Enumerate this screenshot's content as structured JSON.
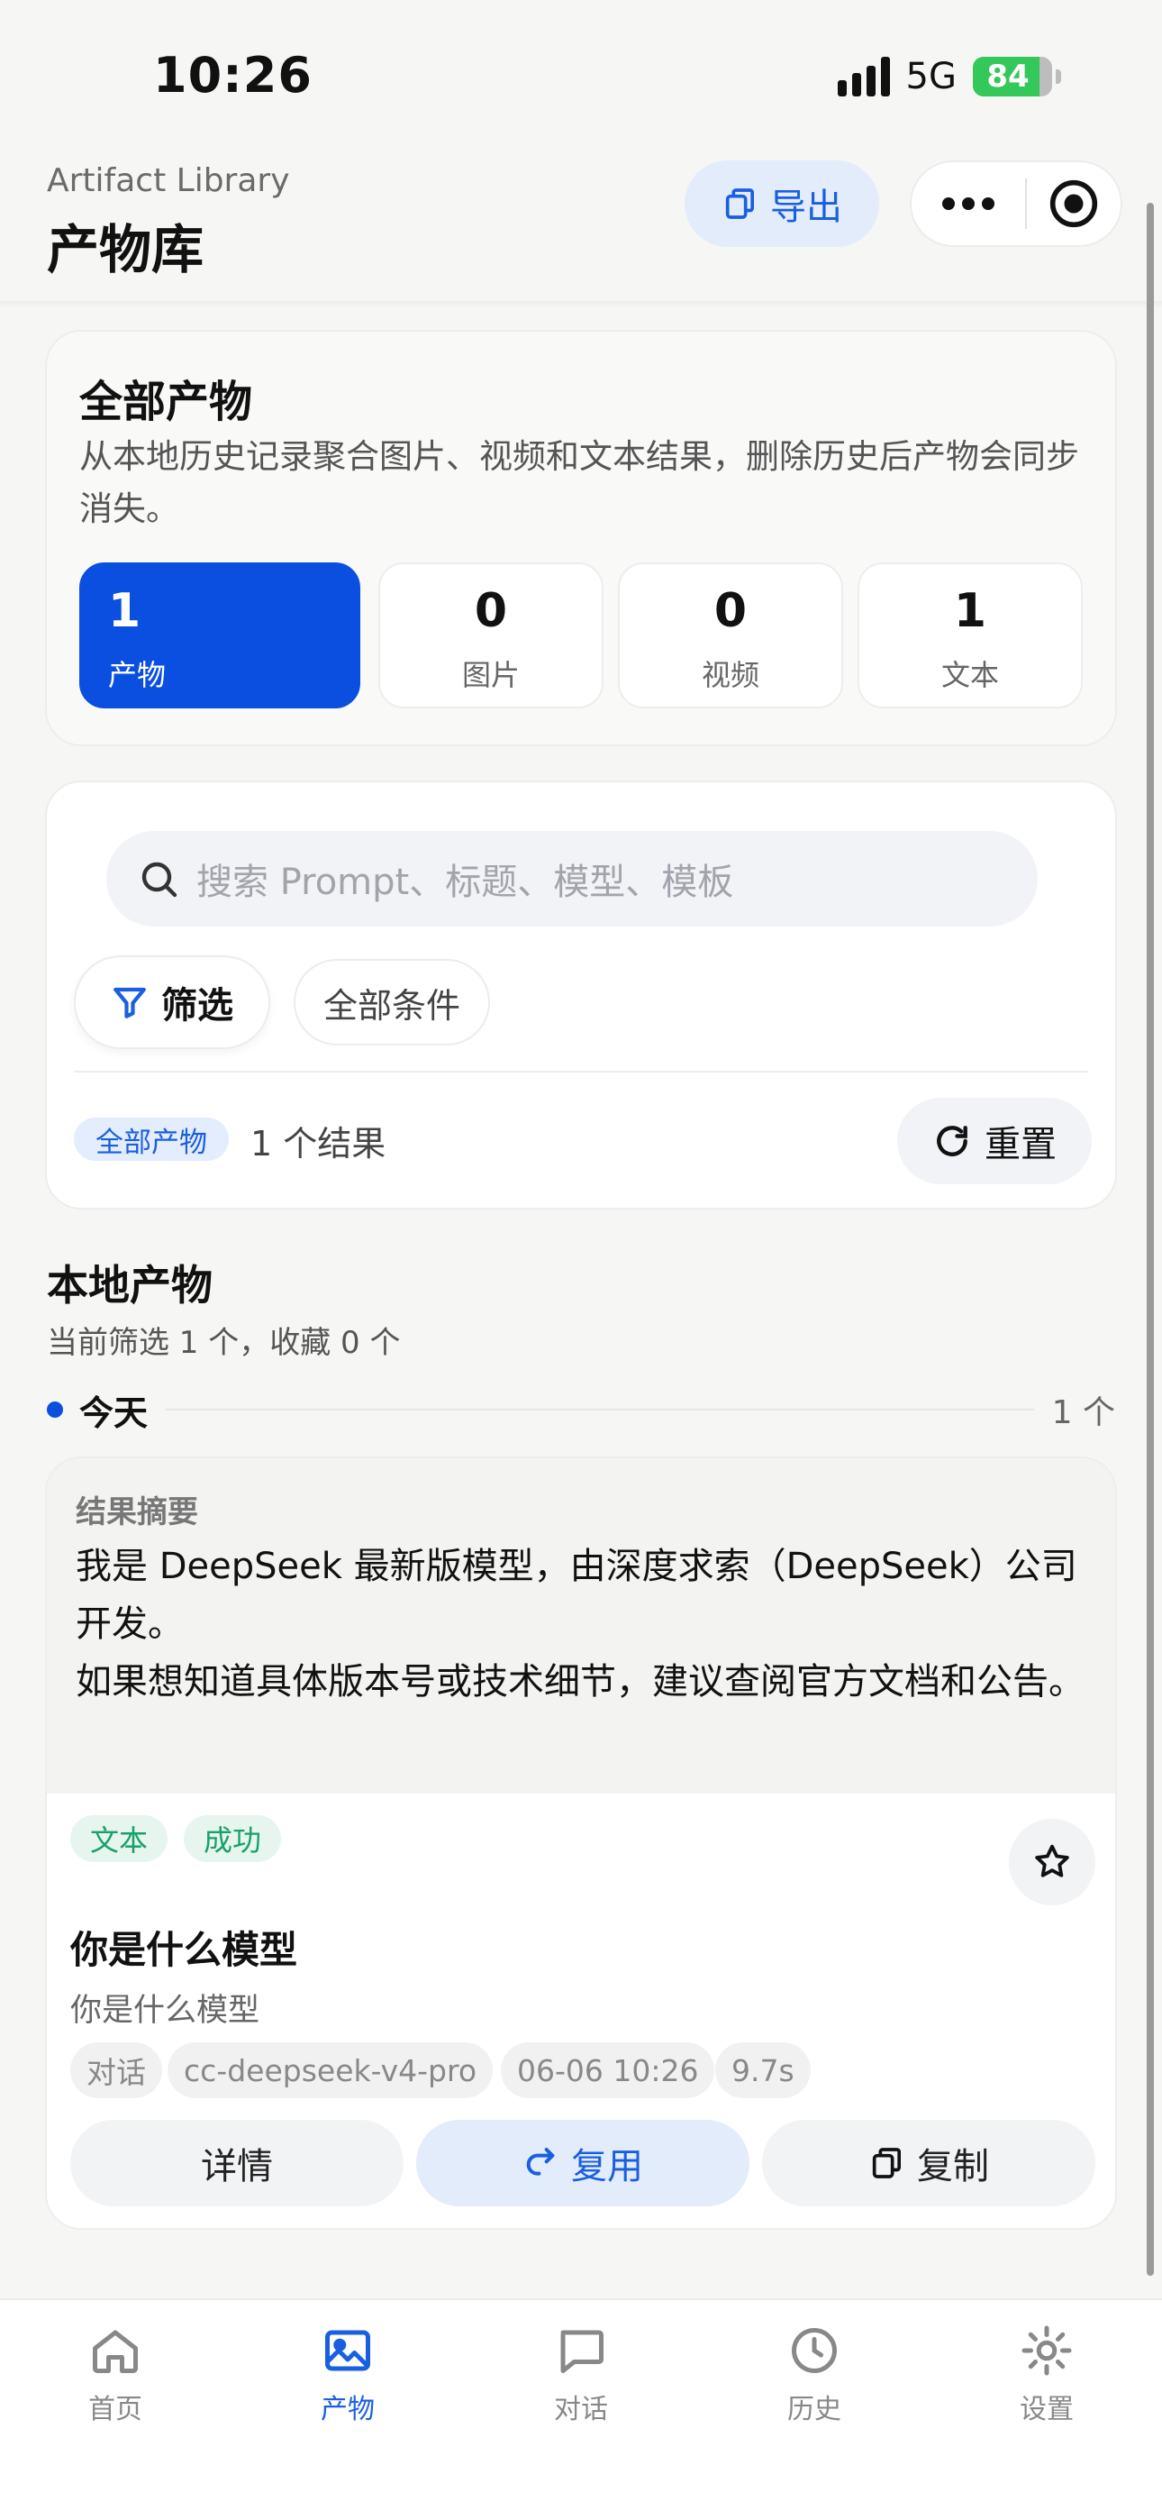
{
  "status_bar": {
    "time": "10:26",
    "network": "5G",
    "battery": "84",
    "battery_level": 0.84
  },
  "header": {
    "subtitle": "Artifact Library",
    "title": "产物库",
    "export_label": "导出"
  },
  "overview": {
    "title": "全部产物",
    "description": "从本地历史记录聚合图片、视频和文本结果，删除历史后产物会同步消失。",
    "stats": [
      {
        "value": "1",
        "label": "产物"
      },
      {
        "value": "0",
        "label": "图片"
      },
      {
        "value": "0",
        "label": "视频"
      },
      {
        "value": "1",
        "label": "文本"
      }
    ]
  },
  "filter": {
    "search_placeholder": "搜索 Prompt、标题、模型、模板",
    "filter_label": "筛选",
    "all_conditions_label": "全部条件",
    "active_tag": "全部产物",
    "result_count": "1 个结果",
    "reset_label": "重置"
  },
  "section": {
    "title": "本地产物",
    "subtitle": "当前筛选 1 个，收藏 0 个",
    "group_label": "今天",
    "group_count": "1 个"
  },
  "artifact": {
    "summary_label": "结果摘要",
    "summary_text": "我是 DeepSeek 最新版模型，由深度求索（DeepSeek）公司开发。\n如果想知道具体版本号或技术细节，建议查阅官方文档和公告。",
    "badges": [
      "文本",
      "成功"
    ],
    "title": "你是什么模型",
    "prompt": "你是什么模型",
    "meta": [
      "对话",
      "cc-deepseek-v4-pro",
      "06-06 10:26",
      "9.7s"
    ],
    "actions": {
      "detail": "详情",
      "reuse": "复用",
      "copy": "复制"
    }
  },
  "tabbar": {
    "items": [
      {
        "label": "首页",
        "icon": "home-icon"
      },
      {
        "label": "产物",
        "icon": "image-icon"
      },
      {
        "label": "对话",
        "icon": "chat-icon"
      },
      {
        "label": "历史",
        "icon": "clock-icon"
      },
      {
        "label": "设置",
        "icon": "settings-icon"
      }
    ],
    "active_index": 1
  },
  "colors": {
    "accent": "#0a4fdf",
    "accent_soft": "#e3ecfb",
    "success": "#1aa06a",
    "background": "#f6f6f4"
  }
}
